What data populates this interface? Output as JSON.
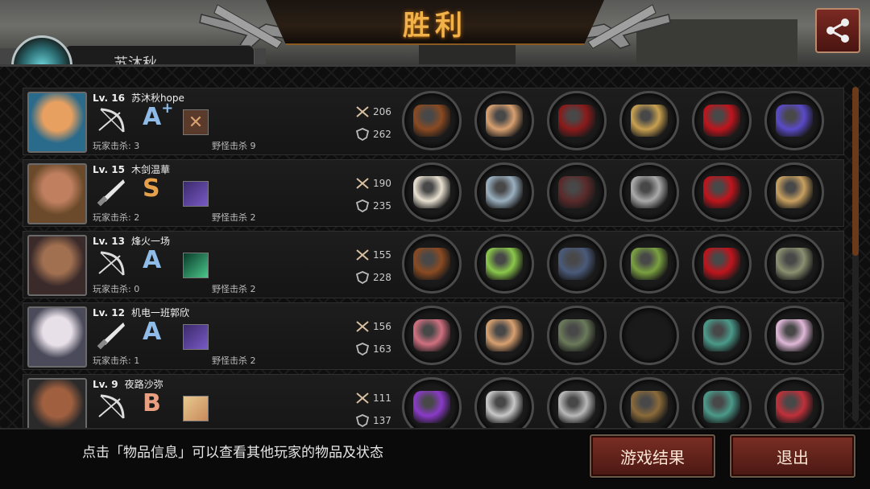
{
  "title": "胜利",
  "team_tab_label": "苏沐秋",
  "players": [
    {
      "level": "Lv. 16",
      "name": "苏沐秋hope",
      "weapon_icon": "bow-icon",
      "grade": "A",
      "grade_plus": "+",
      "grade_color": "#8fbbe8",
      "skill_icon": "crossed-blades-icon",
      "player_kills": "玩家击杀: 3",
      "monster_kills": "野怪击杀 9",
      "attack": "206",
      "defense": "262",
      "items": [
        "crossbow",
        "winged-tiara",
        "red-armor",
        "branch-staff",
        "red-heels",
        "galaxy-orb"
      ]
    },
    {
      "level": "Lv. 15",
      "name": "木剑温華",
      "weapon_icon": "knife-icon",
      "grade": "S",
      "grade_plus": "",
      "grade_color": "#e6a04a",
      "skill_icon": "purple-beast-icon",
      "player_kills": "玩家击杀: 2",
      "monster_kills": "野怪击杀 2",
      "attack": "190",
      "defense": "235",
      "items": [
        "bone-axe",
        "knight-helm",
        "leather-coat",
        "steel-disc",
        "red-heels",
        "treasure-box"
      ]
    },
    {
      "level": "Lv. 13",
      "name": "烽火一场",
      "weapon_icon": "bow-icon",
      "grade": "A",
      "grade_plus": "",
      "grade_color": "#8fbbe8",
      "skill_icon": "green-tech-icon",
      "player_kills": "玩家击杀: 0",
      "monster_kills": "野怪击杀 2",
      "attack": "155",
      "defense": "228",
      "items": [
        "crossbow",
        "laurel-wreath",
        "steel-armor",
        "laptop",
        "red-heels",
        "quiver"
      ]
    },
    {
      "level": "Lv. 12",
      "name": "机电一班郭欣",
      "weapon_icon": "knife-icon",
      "grade": "A",
      "grade_plus": "",
      "grade_color": "#8fbbe8",
      "skill_icon": "purple-beast-icon",
      "player_kills": "玩家击杀: 1",
      "monster_kills": "野怪击杀 2",
      "attack": "156",
      "defense": "163",
      "items": [
        "pink-sword",
        "winged-tiara",
        "vest",
        "empty",
        "sneakers",
        "pearl"
      ]
    },
    {
      "level": "Lv. 9",
      "name": "夜路沙弥",
      "weapon_icon": "bow-icon",
      "grade": "B",
      "grade_plus": "",
      "grade_color": "#e8a080",
      "skill_icon": "blonde-card-icon",
      "player_kills": "",
      "monster_kills": "",
      "attack": "111",
      "defense": "137",
      "items": [
        "purple-bow",
        "silver-circlet",
        "plate-armor",
        "bronze-bell",
        "sneakers",
        "red-quiver"
      ]
    }
  ],
  "footer": {
    "hint": "点击「物品信息」可以查看其他玩家的物品及状态",
    "result_button": "游戏结果",
    "exit_button": "退出"
  }
}
